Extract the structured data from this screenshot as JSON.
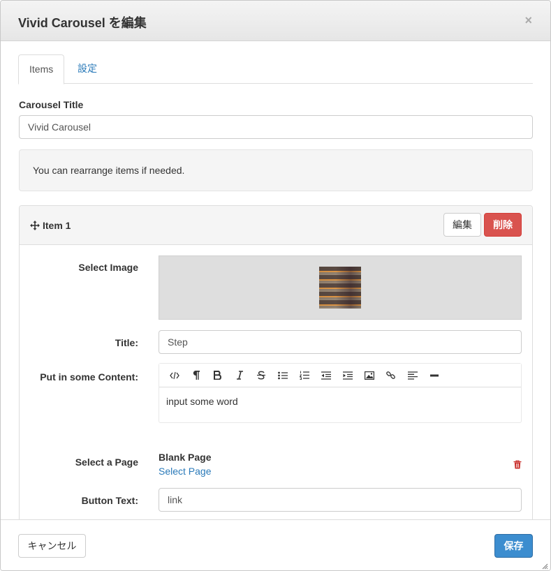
{
  "dialog": {
    "title": "Vivid Carousel を編集",
    "close_symbol": "×"
  },
  "tabs": [
    {
      "label": "Items",
      "active": true
    },
    {
      "label": "設定",
      "active": false
    }
  ],
  "form": {
    "carousel_title_label": "Carousel Title",
    "carousel_title_value": "Vivid Carousel",
    "notice": "You can rearrange items if needed."
  },
  "item": {
    "title": "Item 1",
    "edit_label": "編集",
    "delete_label": "削除",
    "select_image_label": "Select Image",
    "title_label": "Title:",
    "title_value": "Step",
    "content_label": "Put in some Content:",
    "content_text": "input some word",
    "toolbar_icons": [
      "code-view-icon",
      "paragraph-icon",
      "bold-icon",
      "italic-icon",
      "strikethrough-icon",
      "unordered-list-icon",
      "ordered-list-icon",
      "outdent-icon",
      "indent-icon",
      "image-icon",
      "link-icon",
      "align-icon",
      "horizontal-rule-icon"
    ],
    "page_label": "Select a Page",
    "page_name": "Blank Page",
    "page_link": "Select Page",
    "button_text_label": "Button Text:",
    "button_text_value": "link"
  },
  "footer": {
    "cancel_label": "キャンセル",
    "save_label": "保存"
  },
  "colors": {
    "link": "#2a7ab9",
    "danger": "#d9534f",
    "primary": "#3c8dcf"
  }
}
